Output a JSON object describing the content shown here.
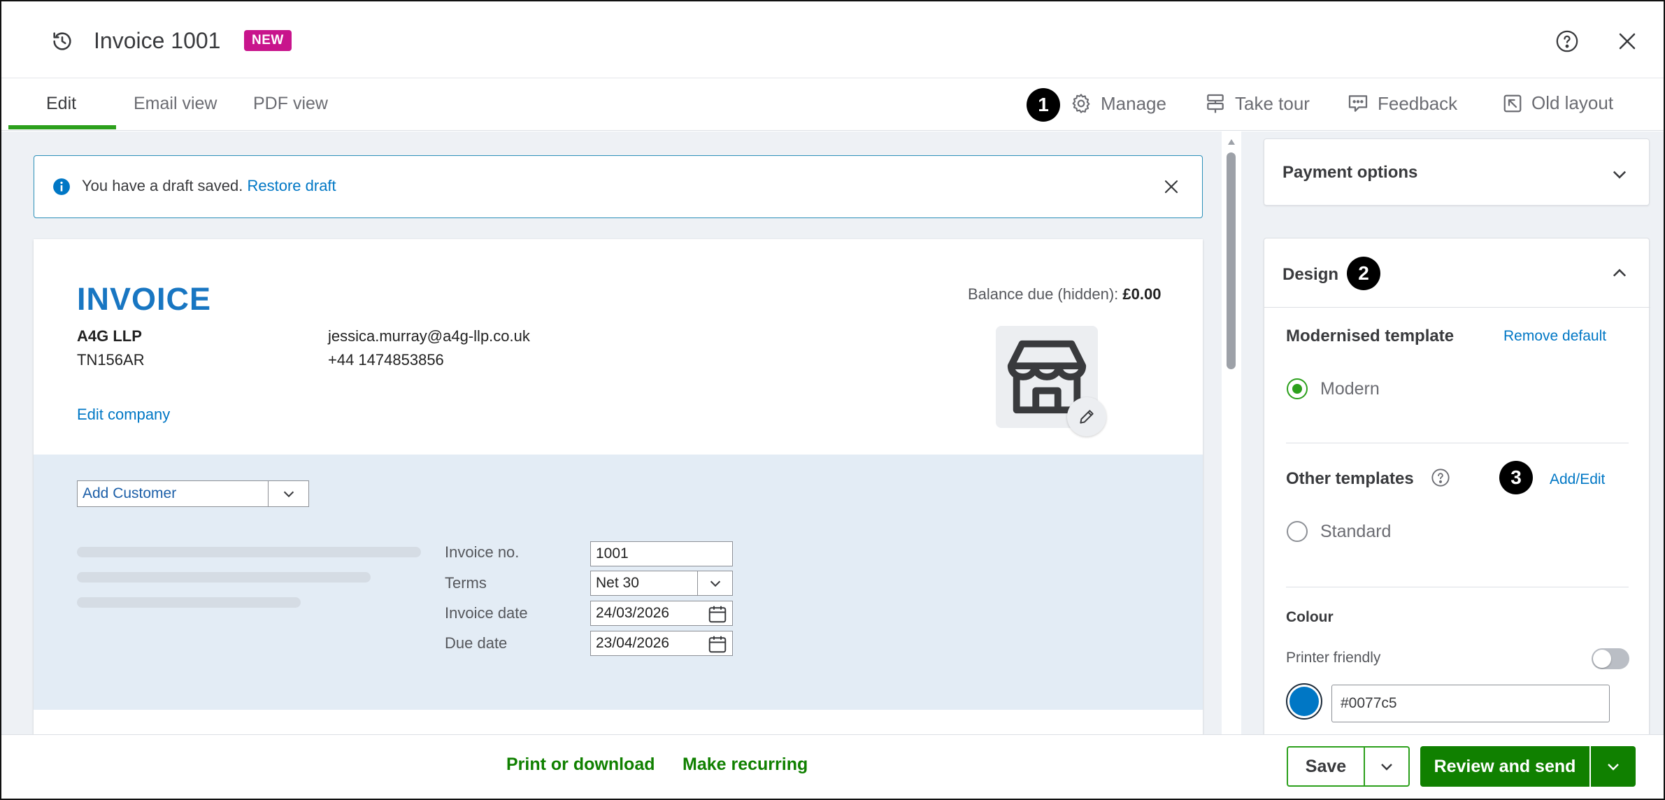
{
  "header": {
    "title": "Invoice 1001",
    "badge": "NEW",
    "icons": [
      "history-icon",
      "help-icon",
      "close-icon"
    ]
  },
  "tabs": [
    {
      "label": "Edit",
      "active": true
    },
    {
      "label": "Email view",
      "active": false
    },
    {
      "label": "PDF view",
      "active": false
    }
  ],
  "toolbar": {
    "callout_1": "1",
    "manage": "Manage",
    "take_tour": "Take tour",
    "feedback": "Feedback",
    "old_layout": "Old layout"
  },
  "draft_banner": {
    "text": "You have a draft saved.",
    "link": "Restore draft"
  },
  "invoice": {
    "heading": "INVOICE",
    "company_name": "A4G LLP",
    "company_postcode": "TN156AR",
    "company_email": "jessica.murray@a4g-llp.co.uk",
    "company_phone": "+44 1474853856",
    "edit_company": "Edit company",
    "balance_label": "Balance due (hidden):",
    "balance_value": "£0.00",
    "accent_color": "#1876c2"
  },
  "customer": {
    "placeholder": "Add Customer"
  },
  "details": {
    "invoice_no_label": "Invoice no.",
    "invoice_no": "1001",
    "terms_label": "Terms",
    "terms": "Net 30",
    "invoice_date_label": "Invoice date",
    "invoice_date": "24/03/2026",
    "due_date_label": "Due date",
    "due_date": "23/04/2026"
  },
  "right_panel": {
    "payment_options": "Payment options",
    "design": "Design",
    "callout_2": "2",
    "modernised_template": "Modernised template",
    "remove_default": "Remove default",
    "modern": "Modern",
    "other_templates": "Other templates",
    "callout_3": "3",
    "add_edit": "Add/Edit",
    "standard": "Standard",
    "colour": "Colour",
    "printer_friendly": "Printer friendly",
    "printer_friendly_on": false,
    "colour_value": "#0077c5"
  },
  "footer": {
    "print_download": "Print or download",
    "make_recurring": "Make recurring",
    "save": "Save",
    "review_send": "Review and send"
  }
}
